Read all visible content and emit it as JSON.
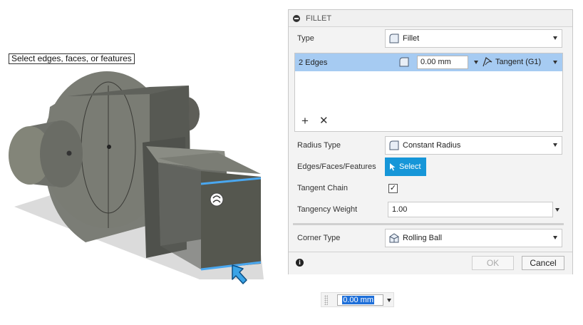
{
  "viewport": {
    "prompt": "Select edges, faces, or features"
  },
  "panel": {
    "title": "FILLET",
    "type_label": "Type",
    "type_value": "Fillet",
    "edges_row": {
      "count": "2 Edges",
      "radius": "0.00 mm",
      "continuity": "Tangent (G1)"
    },
    "radius_type_label": "Radius Type",
    "radius_type_value": "Constant Radius",
    "edges_label": "Edges/Faces/Features",
    "select_label": "Select",
    "tangent_chain_label": "Tangent Chain",
    "tangent_chain_checked": "✓",
    "tangency_weight_label": "Tangency Weight",
    "tangency_weight_value": "1.00",
    "corner_type_label": "Corner Type",
    "corner_type_value": "Rolling Ball",
    "ok_label": "OK",
    "cancel_label": "Cancel"
  },
  "float_input": {
    "value": "0.00 mm"
  },
  "colors": {
    "selection": "#a6cbf2",
    "accent": "#1696d8",
    "model": "#6e6e68"
  }
}
